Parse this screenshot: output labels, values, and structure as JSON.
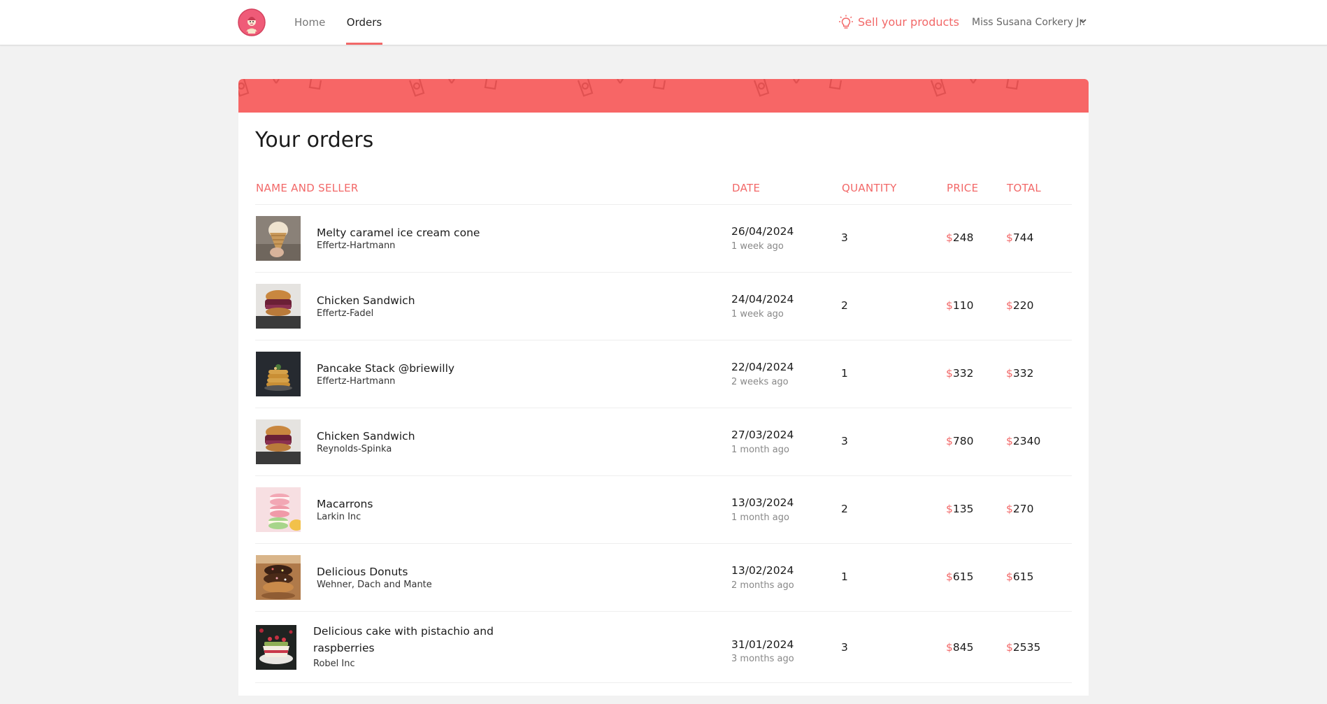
{
  "nav": {
    "home_label": "Home",
    "orders_label": "Orders",
    "sell_label": "Sell your products",
    "user_name": "Miss Susana Corkery Jr."
  },
  "page": {
    "title": "Your orders"
  },
  "table": {
    "headers": {
      "name": "Name and seller",
      "date": "Date",
      "quantity": "Quantity",
      "price": "Price",
      "total": "Total"
    },
    "currency_symbol": "$",
    "rows": [
      {
        "name": "Melty caramel ice cream cone",
        "seller": "Effertz-Hartmann",
        "date": "26/04/2024",
        "ago": "1 week ago",
        "quantity": "3",
        "price": "248",
        "total": "744",
        "image": "ice-cream-cone"
      },
      {
        "name": "Chicken Sandwich",
        "seller": "Effertz-Fadel",
        "date": "24/04/2024",
        "ago": "1 week ago",
        "quantity": "2",
        "price": "110",
        "total": "220",
        "image": "chicken-sandwich"
      },
      {
        "name": "Pancake Stack @briewilly",
        "seller": "Effertz-Hartmann",
        "date": "22/04/2024",
        "ago": "2 weeks ago",
        "quantity": "1",
        "price": "332",
        "total": "332",
        "image": "pancake-stack"
      },
      {
        "name": "Chicken Sandwich",
        "seller": "Reynolds-Spinka",
        "date": "27/03/2024",
        "ago": "1 month ago",
        "quantity": "3",
        "price": "780",
        "total": "2340",
        "image": "chicken-sandwich"
      },
      {
        "name": "Macarrons",
        "seller": "Larkin Inc",
        "date": "13/03/2024",
        "ago": "1 month ago",
        "quantity": "2",
        "price": "135",
        "total": "270",
        "image": "macarons"
      },
      {
        "name": "Delicious Donuts",
        "seller": "Wehner, Dach and Mante",
        "date": "13/02/2024",
        "ago": "2 months ago",
        "quantity": "1",
        "price": "615",
        "total": "615",
        "image": "donuts"
      },
      {
        "name": "Delicious cake with pistachio and raspberries",
        "seller": "Robel Inc",
        "date": "31/01/2024",
        "ago": "3 months ago",
        "quantity": "3",
        "price": "845",
        "total": "2535",
        "image": "pistachio-cake"
      }
    ]
  },
  "colors": {
    "accent": "#f26868",
    "banner": "#f76666",
    "background": "#f2f2f2"
  },
  "icons": [
    "app-logo-icon",
    "lightbulb-icon",
    "chevron-down-icon"
  ]
}
